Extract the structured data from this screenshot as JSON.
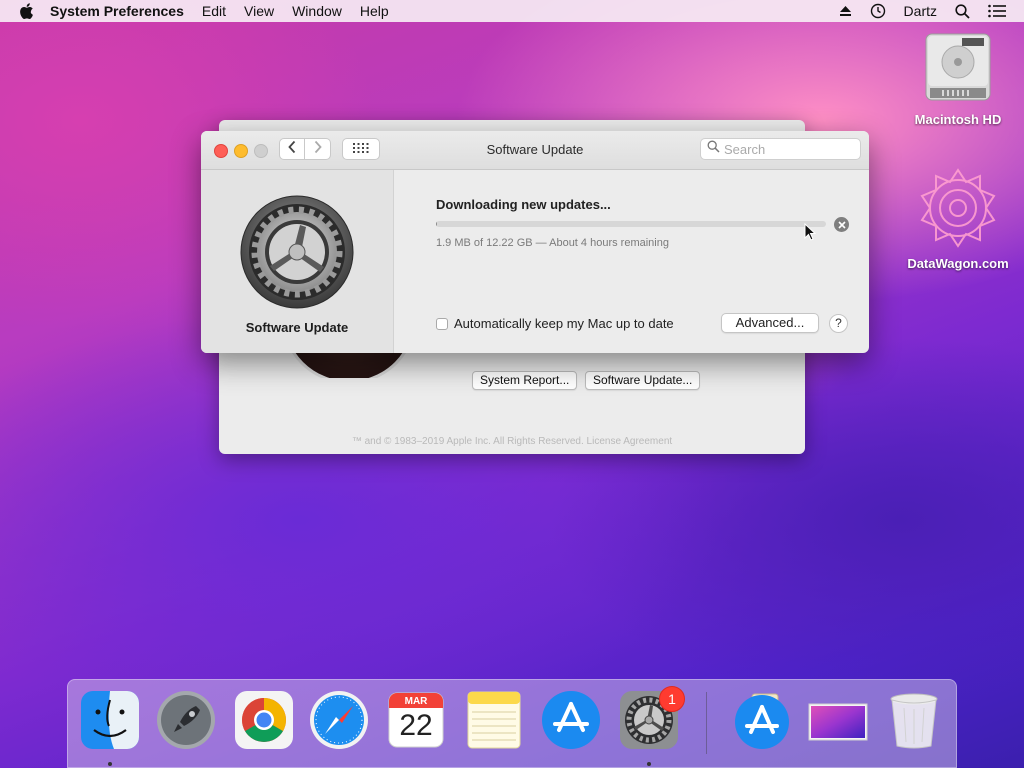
{
  "menubar": {
    "app_name": "System Preferences",
    "items": [
      "Edit",
      "View",
      "Window",
      "Help"
    ],
    "user": "Dartz"
  },
  "desktop": {
    "icons": [
      {
        "label": "Macintosh HD",
        "icon": "hard-drive-icon"
      },
      {
        "label": "DataWagon.com",
        "icon": "datawagon-logo-icon"
      }
    ]
  },
  "back_window": {
    "buttons": [
      "System Report...",
      "Software Update..."
    ],
    "copyright": "™ and © 1983–2019 Apple Inc. All Rights Reserved. License Agreement"
  },
  "window": {
    "title": "Software Update",
    "search_placeholder": "Search",
    "sidebar_label": "Software Update",
    "download": {
      "heading": "Downloading new updates...",
      "status": "1.9 MB of 12.22 GB — About 4 hours remaining",
      "progress_fraction": 0.0002
    },
    "auto_update_label": "Automatically keep my Mac up to date",
    "auto_update_checked": false,
    "advanced_button": "Advanced...",
    "help_button": "?"
  },
  "dock": {
    "items": [
      {
        "name": "Finder",
        "icon": "finder-icon",
        "running": true
      },
      {
        "name": "Launchpad",
        "icon": "launchpad-icon",
        "running": false
      },
      {
        "name": "Google Chrome",
        "icon": "chrome-icon",
        "running": false
      },
      {
        "name": "Safari",
        "icon": "safari-icon",
        "running": false
      },
      {
        "name": "Calendar",
        "icon": "calendar-icon",
        "running": false
      },
      {
        "name": "Notes",
        "icon": "notes-icon",
        "running": false
      },
      {
        "name": "App Store",
        "icon": "app-store-icon",
        "running": false
      },
      {
        "name": "System Preferences",
        "icon": "system-preferences-icon",
        "running": true
      },
      {
        "name": "App Store Downloads",
        "icon": "app-store-download-icon",
        "running": false
      },
      {
        "name": "Desktop Pictures",
        "icon": "wallpaper-icon",
        "running": false
      },
      {
        "name": "Trash",
        "icon": "trash-icon",
        "running": false
      }
    ],
    "calendar": {
      "month": "MAR",
      "day": "22"
    },
    "system_preferences_badge": "1"
  }
}
